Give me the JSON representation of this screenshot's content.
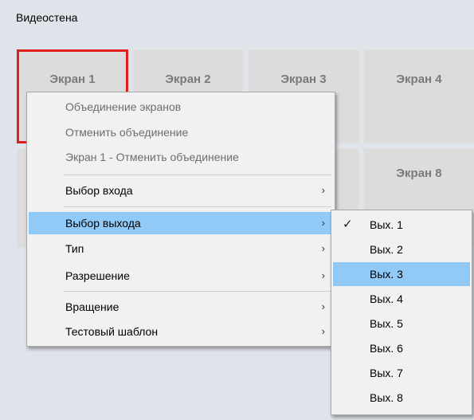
{
  "window": {
    "title": "Видеостена"
  },
  "screens": [
    {
      "label": "Экран 1"
    },
    {
      "label": "Экран 2"
    },
    {
      "label": "Экран 3"
    },
    {
      "label": "Экран 4"
    },
    {
      "label": "Экран 8"
    }
  ],
  "context_menu": {
    "items": [
      {
        "label": "Объединение экранов",
        "disabled": true
      },
      {
        "label": "Отменить объединение",
        "disabled": true
      },
      {
        "label": "Экран 1 - Отменить объединение",
        "disabled": true
      },
      {
        "label": "Выбор входа",
        "submenu": true
      },
      {
        "label": "Выбор выхода",
        "submenu": true,
        "highlighted": true
      },
      {
        "label": "Тип",
        "submenu": true
      },
      {
        "label": "Разрешение",
        "submenu": true
      },
      {
        "label": "Вращение",
        "submenu": true
      },
      {
        "label": "Тестовый шаблон",
        "submenu": true
      }
    ],
    "arrow": "›"
  },
  "output_submenu": {
    "items": [
      {
        "label": "Вых. 1",
        "checked": true
      },
      {
        "label": "Вых. 2"
      },
      {
        "label": "Вых. 3",
        "highlighted": true
      },
      {
        "label": "Вых. 4"
      },
      {
        "label": "Вых. 5"
      },
      {
        "label": "Вых. 6"
      },
      {
        "label": "Вых. 7"
      },
      {
        "label": "Вых. 8"
      }
    ],
    "check_mark": "✓"
  },
  "colors": {
    "background": "#dfe3ea",
    "selection_border": "#e01e1e",
    "highlight": "#91c9f7"
  }
}
